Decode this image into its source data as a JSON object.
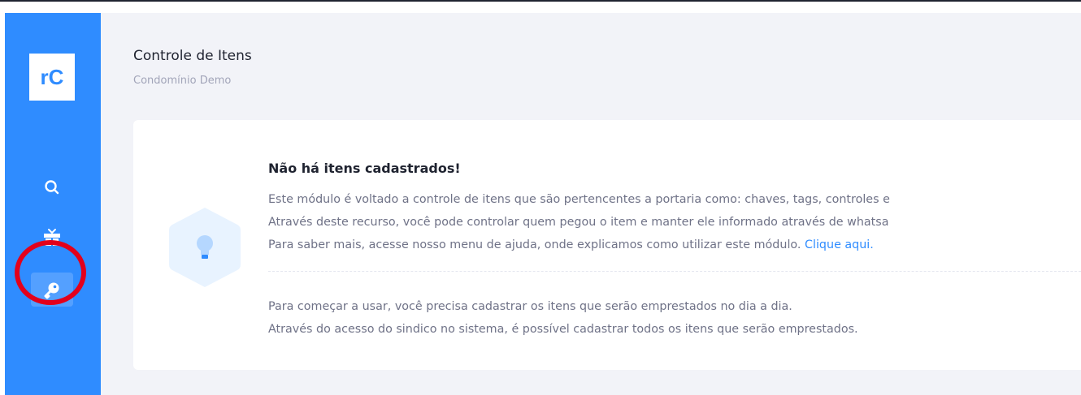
{
  "colors": {
    "sidebar": "#2f8cff",
    "accent": "#2f8cff",
    "highlight_ring": "#e3001b",
    "background": "#f2f3f8"
  },
  "sidebar": {
    "logo_text": "rC",
    "nav": [
      {
        "icon": "search-icon",
        "active": false
      },
      {
        "icon": "gift-icon",
        "active": false
      },
      {
        "icon": "key-icon",
        "active": true
      }
    ]
  },
  "header": {
    "title": "Controle de Itens",
    "subtitle": "Condomínio Demo"
  },
  "empty_state": {
    "icon": "lightbulb-icon",
    "title": "Não há itens cadastrados!",
    "line1": "Este módulo é voltado a controle de itens que são pertencentes a portaria como: chaves, tags, controles e",
    "line2": "Através deste recurso, você pode controlar quem pegou o item e manter ele informado através de whatsa",
    "line3": "Para saber mais, acesse nosso menu de ajuda, onde explicamos como utilizar este módulo.",
    "link": "Clique aqui.",
    "line4": "Para começar a usar, você precisa cadastrar os itens que serão emprestados no dia a dia.",
    "line5": "Através do acesso do sindico no sistema, é possível cadastrar todos os itens que serão emprestados."
  }
}
